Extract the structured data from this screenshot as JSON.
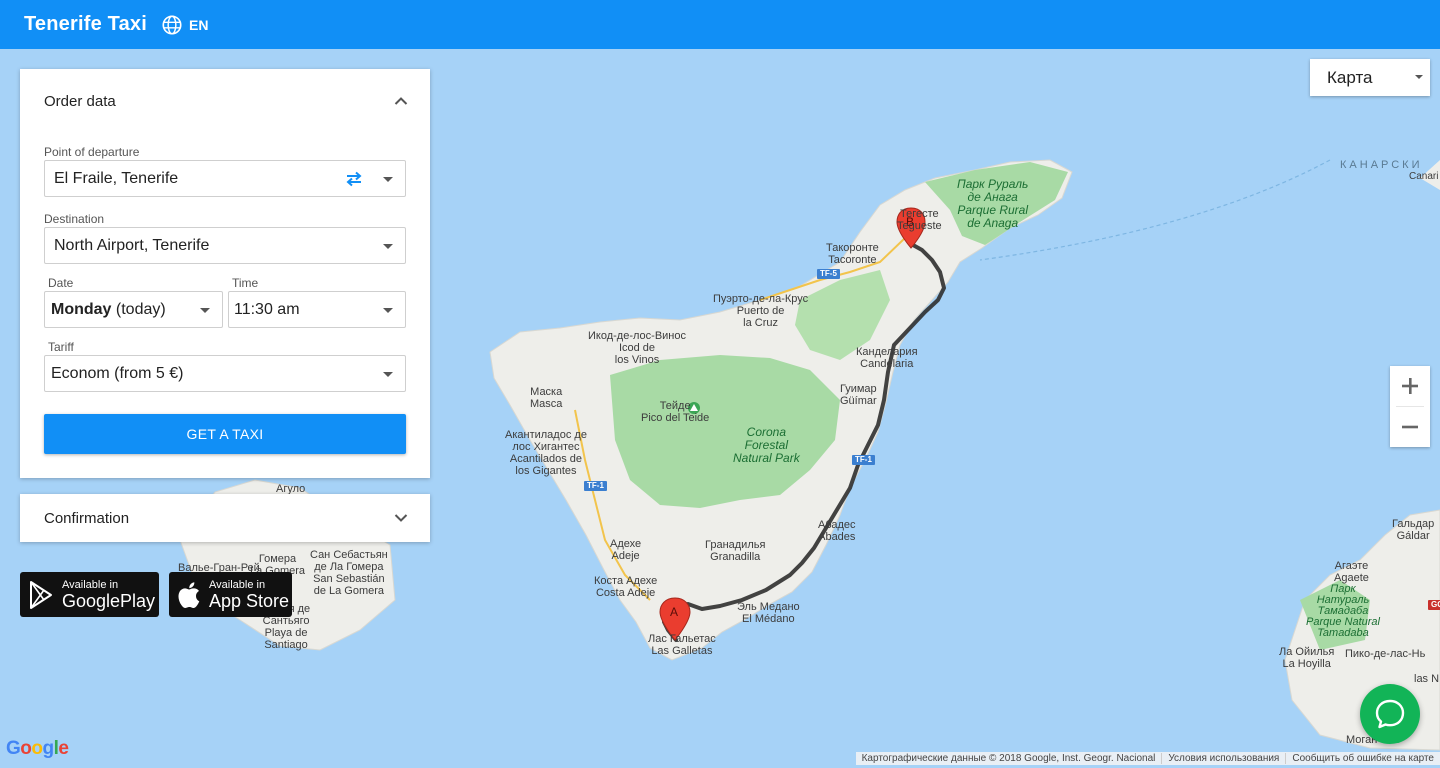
{
  "app": {
    "title": "Tenerife Taxi",
    "language": "EN"
  },
  "order_panel": {
    "title": "Order data",
    "departure": {
      "label": "Point of departure",
      "value": "El Fraile, Tenerife"
    },
    "destination": {
      "label": "Destination",
      "value": "North Airport, Tenerife"
    },
    "date": {
      "label": "Date",
      "day": "Monday",
      "suffix": " (today)"
    },
    "time": {
      "label": "Time",
      "value": "11:30 am"
    },
    "tariff": {
      "label": "Tariff",
      "value": "Econom (from 5 €)"
    },
    "submit_label": "GET A TAXI"
  },
  "confirmation_panel": {
    "title": "Confirmation"
  },
  "stores": {
    "google": {
      "small": "Available in",
      "big": "GooglePlay"
    },
    "apple": {
      "small": "Available in",
      "big": "App Store"
    }
  },
  "map": {
    "type_selector": "Карта",
    "marker_a": "A",
    "marker_b": "B",
    "attribution": [
      "Картографические данные © 2018 Google, Inst. Geogr. Nacional",
      "Условия использования",
      "Сообщить об ошибке на карте"
    ],
    "google_logo": "Google",
    "places": {
      "tacoronte": "Такоронте\nTacoronte",
      "tegueste": "Тегесте\nTegueste",
      "puerto": "Пуэрто-де-ла-Крус\nPuerto de\nla Cruz",
      "icod": "Икод-де-лос-Винос\nIcod de\nlos Vinos",
      "candelaria": "Канделария\nCandelaria",
      "guimar": "Гуимар\nGüímar",
      "masca": "Маска\nMasca",
      "teide": "Тейде\nPico del Teide",
      "acantilados": "Акантиладос де\nлос Хигантес\nAcantilados de\nlos Gigantes",
      "granadilla": "Гранадилья\nGranadilla",
      "abades": "Абадес\nAbades",
      "adeje": "Адехе\nAdeje",
      "costa_adeje": "Коста Адехе\nCosta Adeje",
      "medano": "Эль Медано\nEl Médano",
      "galletas": "Лас Гальетас\nLas Galletas",
      "agulo": "Агуло",
      "gomera": "Гомера\nLa Gomera",
      "san_sebastian": "Сан Себастьян\nде Ла Гомера\nSan Sebastián\nde La Gomera",
      "valle": "Валье-Гран-Рей",
      "santiago": "Плайя де\nСантьяго\nPlaya de\nSantiago",
      "galdar": "Гальдар\nGáldar",
      "agaete": "Агаэте\nAgaete",
      "hoyilla": "Ла Ойилья\nLa Hoyilla",
      "pico_nieves": "Пико-де-лас-Нь",
      "nieves_short": "las N",
      "mogan": "Моган",
      "canarias_ru": "КАНАРСКИ",
      "canarias": "Canari"
    },
    "parks": {
      "anaga": "Парк Рураль\nде Анага\nParque Rural\nde Anaga",
      "corona": "Corona\nForestal\nNatural Park",
      "tamadaba": "Парк\nНатураль\nТамадаба\nParque Natural\nTamadaba"
    },
    "roads": {
      "tf5": "TF-5",
      "tf1_a": "TF-1",
      "tf1_b": "TF-1",
      "gc": "GC"
    }
  }
}
